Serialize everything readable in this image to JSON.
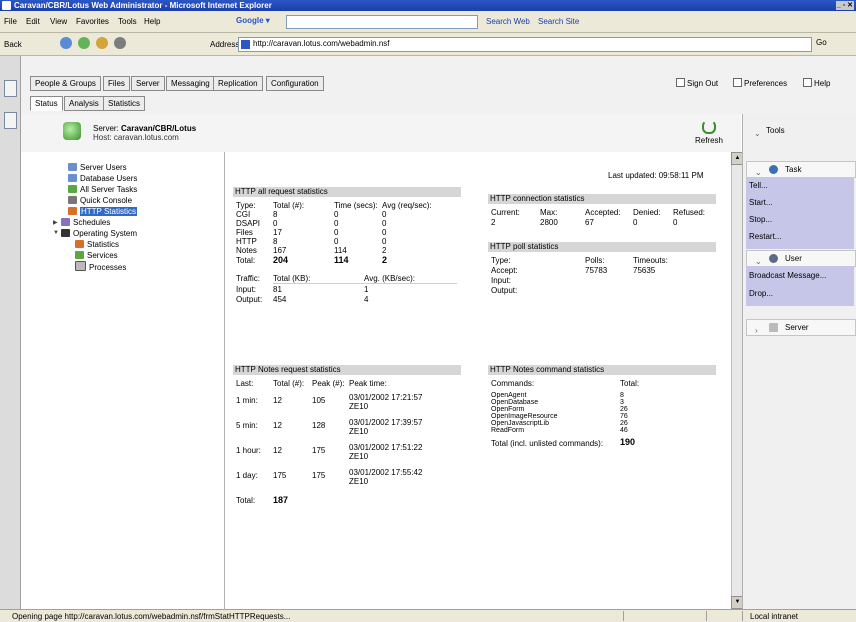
{
  "window": {
    "title": "Caravan/CBR/Lotus Web Administrator - Microsoft Internet Explorer",
    "controls": "_ ▫ ✕"
  },
  "menu": {
    "items": [
      "File",
      "Edit",
      "View",
      "Favorites",
      "Tools",
      "Help"
    ],
    "google_label": "Google ▾",
    "search_web": "Search Web",
    "search_site": "Search Site"
  },
  "nav": {
    "back": "Back",
    "address_label": "Address",
    "address_value": "http://caravan.lotus.com/webadmin.nsf",
    "go": "Go"
  },
  "tabs": {
    "main": [
      "People & Groups",
      "Files",
      "Server",
      "Messaging",
      "Replication",
      "Configuration"
    ],
    "sub": [
      "Status",
      "Analysis",
      "Statistics"
    ],
    "links": [
      "Sign Out",
      "Preferences",
      "Help"
    ]
  },
  "server": {
    "label": "Server:",
    "name": "Caravan/CBR/Lotus",
    "host_label": "Host:",
    "host": "caravan.lotus.com",
    "refresh": "Refresh"
  },
  "tree": {
    "items": [
      {
        "label": "Server Users"
      },
      {
        "label": "Database Users"
      },
      {
        "label": "All Server Tasks"
      },
      {
        "label": "Quick Console"
      },
      {
        "label": "HTTP Statistics"
      },
      {
        "label": "Schedules"
      },
      {
        "label": "Operating System"
      },
      {
        "label": "Statistics"
      },
      {
        "label": "Services"
      },
      {
        "label": "Processes"
      }
    ]
  },
  "content": {
    "last_updated": "Last updated: 09:58:11 PM",
    "all_requests": {
      "title": "HTTP all request statistics",
      "headers": [
        "Type:",
        "Total (#):",
        "Time (secs):",
        "Avg (req/sec):"
      ],
      "rows": [
        [
          "CGI",
          "8",
          "0",
          "0"
        ],
        [
          "DSAPI",
          "0",
          "0",
          "0"
        ],
        [
          "Files",
          "17",
          "0",
          "0"
        ],
        [
          "HTTP",
          "8",
          "0",
          "0"
        ],
        [
          "Notes",
          "167",
          "114",
          "2"
        ]
      ],
      "total": [
        "Total:",
        "204",
        "114",
        "2"
      ]
    },
    "traffic": {
      "headers": [
        "Traffic:",
        "Total (KB):",
        "Avg. (KB/sec):"
      ],
      "rows": [
        [
          "Input:",
          "81",
          "1"
        ],
        [
          "Output:",
          "454",
          "4"
        ]
      ]
    },
    "connection": {
      "title": "HTTP connection statistics",
      "headers": [
        "Current:",
        "Max:",
        "Accepted:",
        "Denied:",
        "Refused:"
      ],
      "values": [
        "2",
        "2800",
        "67",
        "0",
        "0"
      ]
    },
    "poll": {
      "title": "HTTP poll statistics",
      "headers": [
        "Type:",
        "Polls:",
        "Timeouts:"
      ],
      "rows": [
        [
          "Accept:",
          "75783",
          "75635"
        ],
        [
          "Input:",
          "",
          ""
        ],
        [
          "Output:",
          "",
          ""
        ]
      ]
    },
    "notes_requests": {
      "title": "HTTP Notes request statistics",
      "headers": [
        "Last:",
        "Total (#):",
        "Peak (#):",
        "Peak time:"
      ],
      "rows": [
        [
          "1 min:",
          "12",
          "105",
          "03/01/2002 17:21:57",
          "ZE10"
        ],
        [
          "5 min:",
          "12",
          "128",
          "03/01/2002 17:39:57",
          "ZE10"
        ],
        [
          "1 hour:",
          "12",
          "175",
          "03/01/2002 17:51:22",
          "ZE10"
        ],
        [
          "1 day:",
          "175",
          "175",
          "03/01/2002 17:55:42",
          "ZE10"
        ]
      ],
      "total": [
        "Total:",
        "187"
      ]
    },
    "notes_commands": {
      "title": "HTTP Notes command statistics",
      "headers": [
        "Commands:",
        "Total:"
      ],
      "rows": [
        [
          "OpenAgent",
          "8"
        ],
        [
          "OpenDatabase",
          "3"
        ],
        [
          "OpenForm",
          "26"
        ],
        [
          "OpenImageResource",
          "76"
        ],
        [
          "OpenJavascriptLib",
          "26"
        ],
        [
          "ReadForm",
          "46"
        ]
      ],
      "total": [
        "Total (incl. unlisted commands):",
        "190"
      ]
    }
  },
  "tools": {
    "header": "Tools",
    "task_section": "Task",
    "task_items": [
      "Tell...",
      "Start...",
      "Stop...",
      "Restart..."
    ],
    "user_section": "User",
    "user_items": [
      "Broadcast Message...",
      "Drop..."
    ],
    "server_section": "Server"
  },
  "status": {
    "text": "Opening page http://caravan.lotus.com/webadmin.nsf/frmStatHTTPRequests...",
    "zone": "Local intranet"
  }
}
